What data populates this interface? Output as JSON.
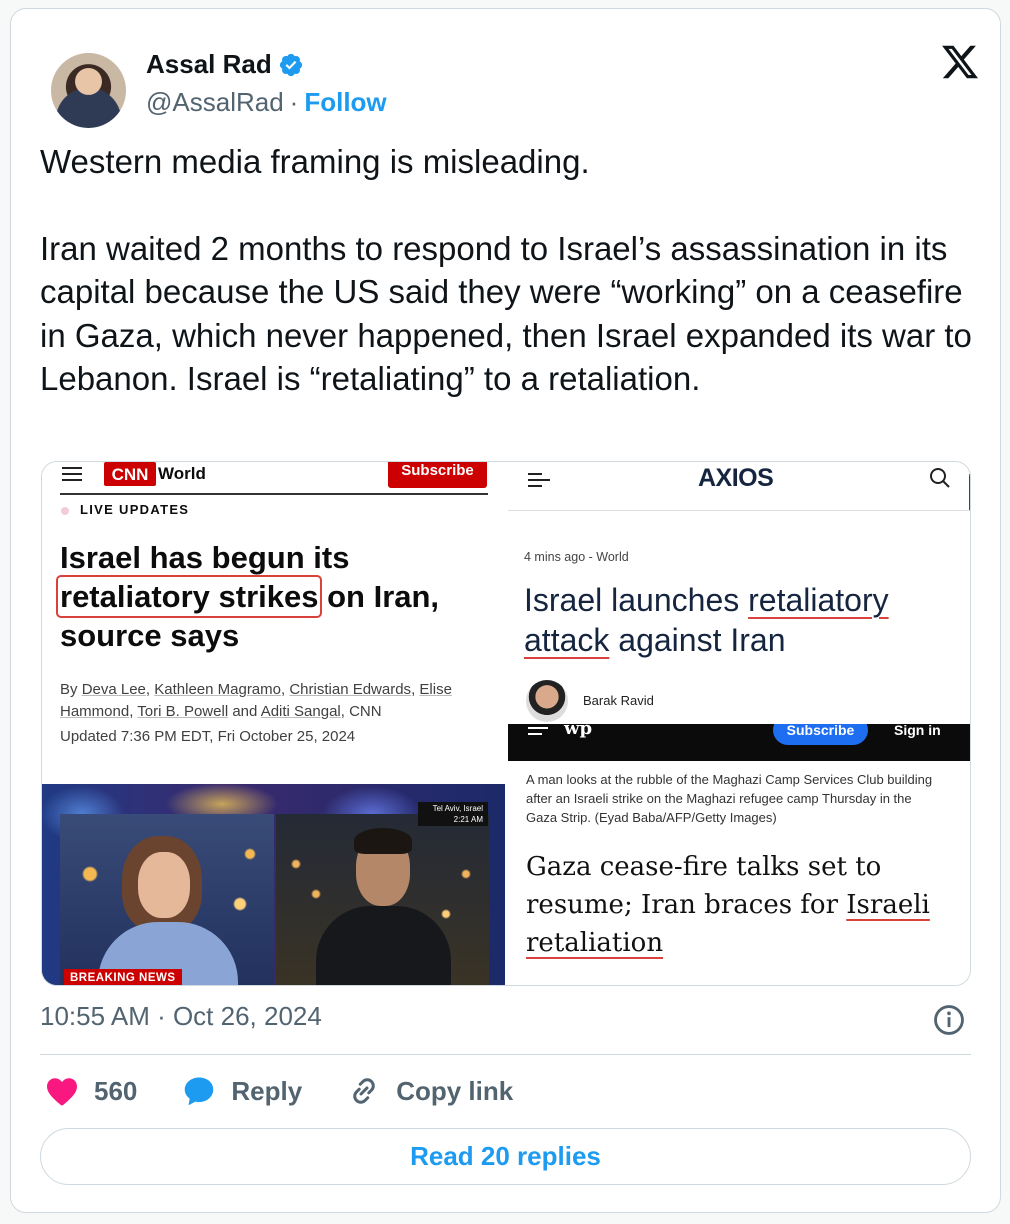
{
  "author": {
    "name": "Assal Rad",
    "handle": "@AssalRad",
    "separator": "·",
    "follow_label": "Follow"
  },
  "tweet": {
    "paragraphs": [
      "Western media framing is misleading.",
      "Iran waited 2 months to respond to Israel’s assassination in its capital because the US said they were “working” on a ceasefire in Gaza, which never happened, then Israel expanded its war to Lebanon. Israel is “retaliating” to a retaliation."
    ],
    "timestamp": "10:55 AM · Oct 26, 2024"
  },
  "media": {
    "cnn": {
      "logo_text": "CNN",
      "section": "World",
      "subscribe": "Subscribe",
      "live_label": "LIVE UPDATES",
      "headline_pre": "Israel has begun its",
      "headline_boxed": "retaliatory strikes",
      "headline_post": " on Iran, source says",
      "byline_prefix": "By ",
      "authors": [
        "Deva Lee",
        "Kathleen Magramo",
        "Christian Edwards",
        "Elise Hammond",
        "Tori B. Powell",
        "Aditi Sangal"
      ],
      "byline_suffix": ", CNN",
      "updated": "Updated 7:36 PM EDT, Fri October 25, 2024",
      "video_location": "Tel Aviv, Israel",
      "video_time": "2:21 AM",
      "breaking": "BREAKING NEWS"
    },
    "axios": {
      "logo": "AXIOS",
      "meta": "4 mins ago - World",
      "headline_pre": "Israel launches ",
      "headline_u1": "retaliatory",
      "headline_u2": "attack",
      "headline_post": " against Iran",
      "author": "Barak Ravid"
    },
    "wapo": {
      "logo": "wp",
      "subscribe": "Subscribe",
      "sign_in": "Sign in",
      "caption": "A man looks at the rubble of the Maghazi Camp Services Club building after an Israeli strike on the Maghazi refugee camp Thursday in the Gaza Strip. (Eyad Baba/AFP/Getty Images)",
      "headline_pre": "Gaza cease-fire talks set to resume; Iran braces for ",
      "headline_u1": "Israeli",
      "headline_u2": "retaliation"
    }
  },
  "actions": {
    "like_count": "560",
    "reply_label": "Reply",
    "copy_label": "Copy link"
  },
  "read_replies": "Read 20 replies",
  "colors": {
    "accent": "#1d9bf0",
    "like": "#f91880",
    "secondary_text": "#536471",
    "cnn_red": "#cc0000"
  }
}
